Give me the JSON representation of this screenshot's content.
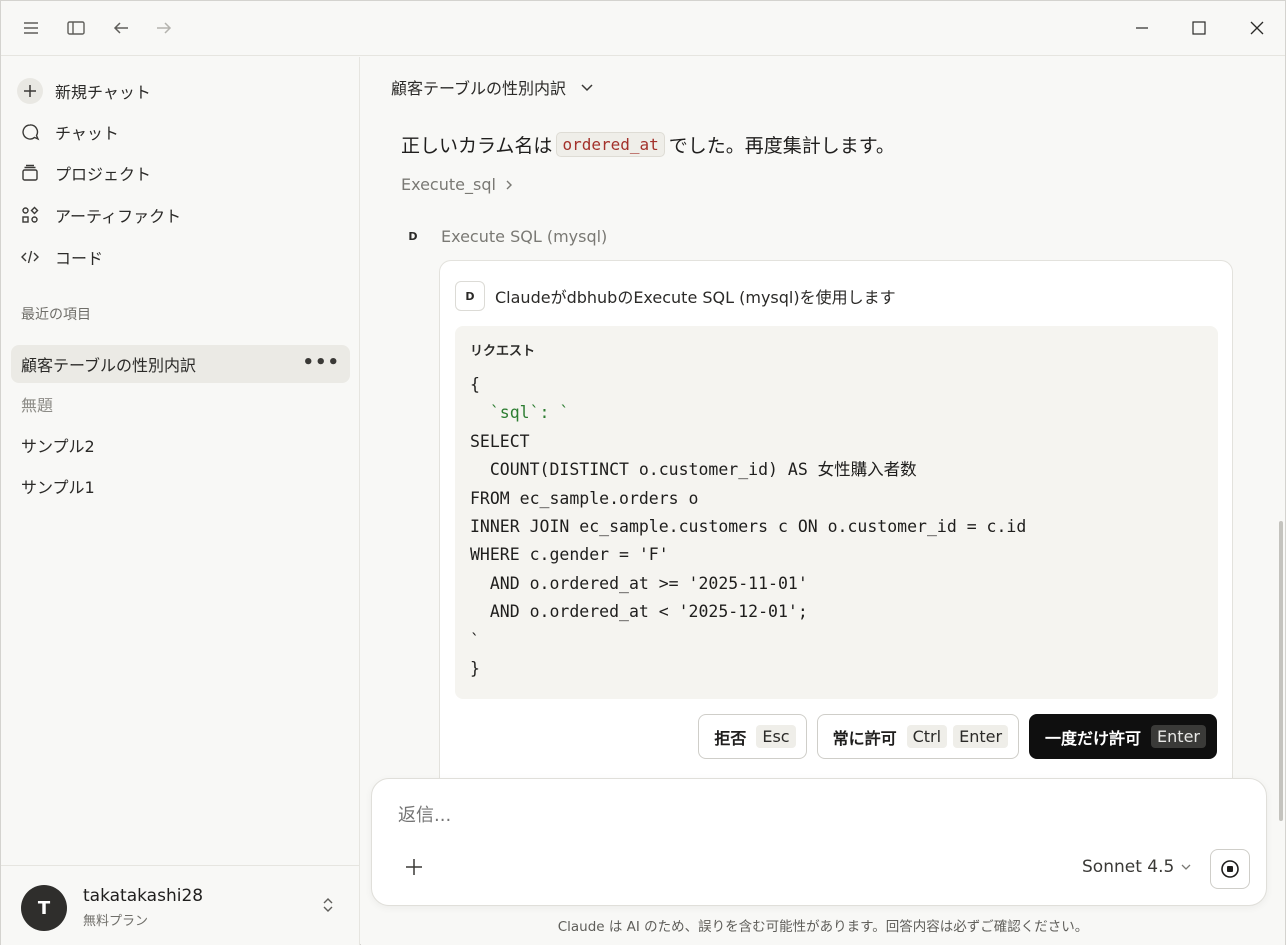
{
  "sidebar": {
    "nav": [
      {
        "label": "新規チャット",
        "icon": "plus-icon"
      },
      {
        "label": "チャット",
        "icon": "chat-icon"
      },
      {
        "label": "プロジェクト",
        "icon": "folder-icon"
      },
      {
        "label": "アーティファクト",
        "icon": "artifacts-icon"
      },
      {
        "label": "コード",
        "icon": "code-icon"
      }
    ],
    "recent_label": "最近の項目",
    "recent": [
      {
        "label": "顧客テーブルの性別内訳"
      },
      {
        "label": "無題"
      },
      {
        "label": "サンプル2"
      },
      {
        "label": "サンプル1"
      }
    ],
    "more": "•••",
    "user": {
      "initial": "T",
      "name": "takatakashi28",
      "plan": "無料プラン"
    }
  },
  "main": {
    "title": "顧客テーブルの性別内訳",
    "message": {
      "before": "正しいカラム名は",
      "code": "ordered_at",
      "after": "でした。再度集計します。"
    },
    "tool_link": "Execute_sql",
    "tool_badge": "D",
    "tool_name": "Execute SQL (mysql)",
    "permission": {
      "badge": "D",
      "heading": "ClaudeがdbhubのExecute SQL (mysql)を使用します",
      "request_label": "リクエスト",
      "code_lines": [
        "{",
        "  `sql`: `",
        "SELECT",
        "  COUNT(DISTINCT o.customer_id) AS 女性購入者数",
        "FROM ec_sample.orders o",
        "INNER JOIN ec_sample.customers c ON o.customer_id = c.id",
        "WHERE c.gender = 'F'",
        "  AND o.ordered_at >= '2025-11-01'",
        "  AND o.ordered_at < '2025-12-01';",
        "`",
        "}"
      ],
      "deny": {
        "label": "拒否",
        "key": "Esc"
      },
      "always": {
        "label": "常に許可",
        "key1": "Ctrl",
        "key2": "Enter"
      },
      "once": {
        "label": "一度だけ許可",
        "key": "Enter"
      }
    },
    "composer": {
      "placeholder": "返信...",
      "model": "Sonnet 4.5"
    },
    "disclaimer": "Claude は AI のため、誤りを含む可能性があります。回答内容は必ずご確認ください。"
  }
}
